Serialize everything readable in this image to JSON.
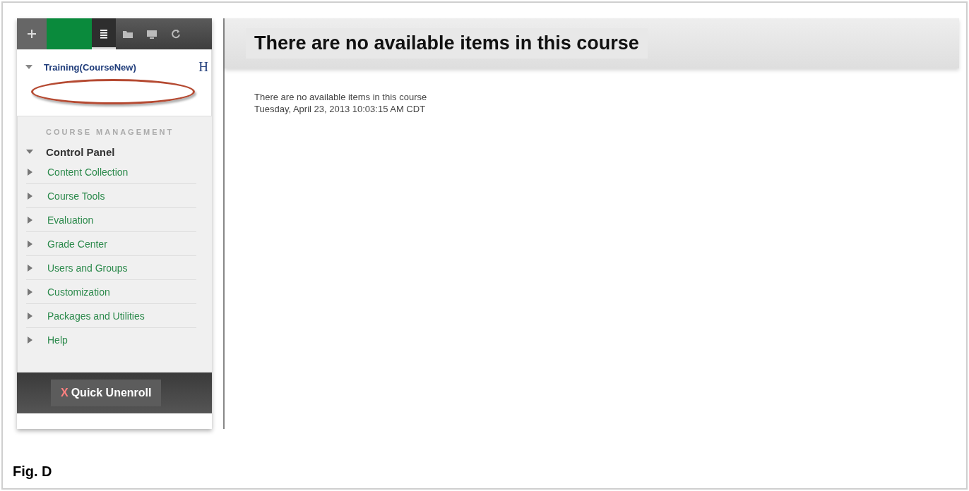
{
  "toolbar": [
    {
      "kind": "plus",
      "selected": false
    },
    {
      "kind": "swatch",
      "selected": false
    },
    {
      "kind": "list",
      "selected": true
    },
    {
      "kind": "folder",
      "selected": false
    },
    {
      "kind": "screen",
      "selected": false
    },
    {
      "kind": "refresh",
      "selected": false
    }
  ],
  "course": {
    "title": "Training(CourseNew)",
    "expanded": true,
    "letter": "H"
  },
  "management": {
    "heading": "COURSE MANAGEMENT",
    "panel": {
      "label": "Control Panel",
      "expanded": true
    },
    "items": [
      {
        "label": "Content Collection",
        "expanded": false
      },
      {
        "label": "Course Tools",
        "expanded": false
      },
      {
        "label": "Evaluation",
        "expanded": false
      },
      {
        "label": "Grade Center",
        "expanded": false
      },
      {
        "label": "Users and Groups",
        "expanded": false
      },
      {
        "label": "Customization",
        "expanded": false
      },
      {
        "label": "Packages and Utilities",
        "expanded": false
      },
      {
        "label": "Help",
        "expanded": false
      }
    ]
  },
  "unenroll": {
    "icon": "X",
    "label": "Quick Unenroll"
  },
  "main": {
    "heading": "There are no available items in this course",
    "message": "There are no available items in this course",
    "timestamp": "Tuesday, April 23, 2013 10:03:15 AM CDT"
  },
  "caption": "Fig. D"
}
